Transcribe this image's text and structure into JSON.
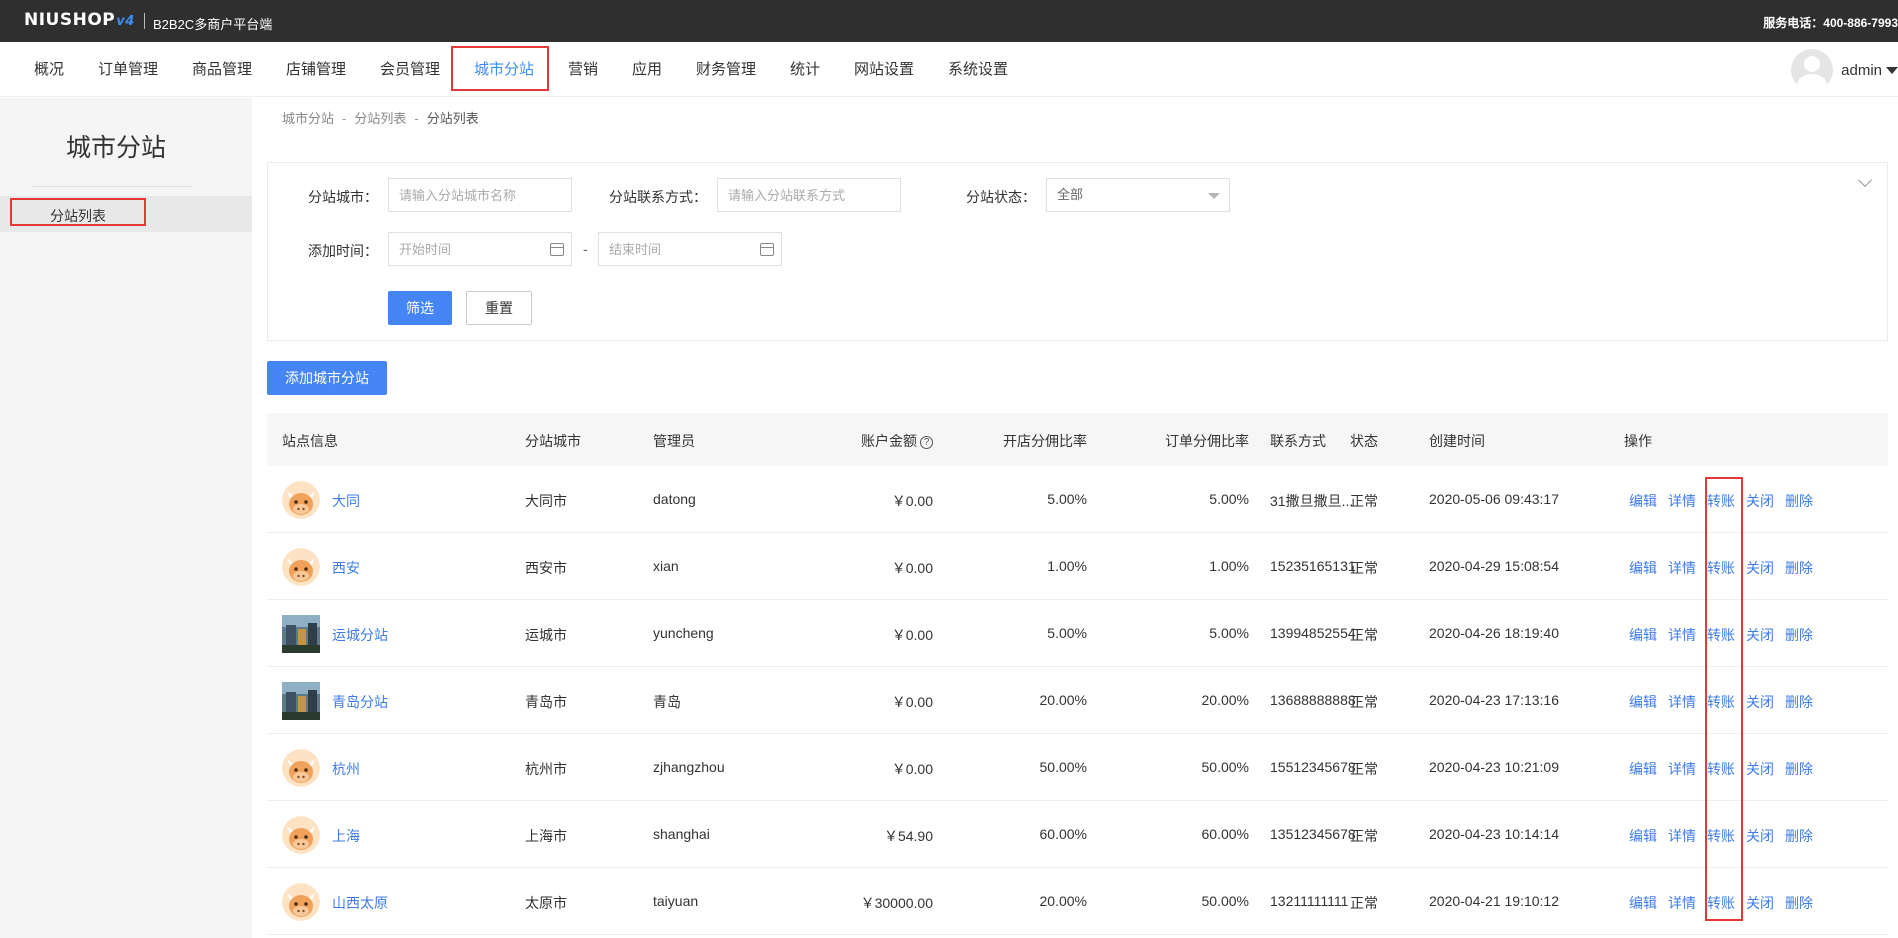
{
  "topbar": {
    "logo_text": "NIUSHOP",
    "logo_version": "v4",
    "platform": "B2B2C多商户平台端",
    "hotline": "服务电话：400-886-7993"
  },
  "nav": {
    "items": [
      "概况",
      "订单管理",
      "商品管理",
      "店铺管理",
      "会员管理",
      "城市分站",
      "营销",
      "应用",
      "财务管理",
      "统计",
      "网站设置",
      "系统设置"
    ],
    "active": "城市分站",
    "user": "admin"
  },
  "sidebar": {
    "title": "城市分站",
    "items": [
      "分站列表"
    ]
  },
  "breadcrumb": [
    "城市分站",
    "分站列表",
    "分站列表"
  ],
  "filter": {
    "city_label": "分站城市：",
    "city_placeholder": "请输入分站城市名称",
    "contact_label": "分站联系方式：",
    "contact_placeholder": "请输入分站联系方式",
    "status_label": "分站状态：",
    "status_value": "全部",
    "time_label": "添加时间：",
    "start_placeholder": "开始时间",
    "end_placeholder": "结束时间",
    "dash": "-",
    "filter_btn": "筛选",
    "reset_btn": "重置"
  },
  "add_btn": "添加城市分站",
  "table": {
    "headers": {
      "site": "站点信息",
      "city": "分站城市",
      "admin": "管理员",
      "balance": "账户金额",
      "shop_rate": "开店分佣比率",
      "order_rate": "订单分佣比率",
      "contact": "联系方式",
      "status": "状态",
      "created": "创建时间",
      "ops": "操作"
    },
    "rows": [
      {
        "name": "大同",
        "city": "大同市",
        "admin": "datong",
        "balance": "￥0.00",
        "shop_rate": "5.00%",
        "order_rate": "5.00%",
        "contact": "31撒旦撒旦...",
        "status": "正常",
        "created": "2020-05-06 09:43:17",
        "avatar": "bull"
      },
      {
        "name": "西安",
        "city": "西安市",
        "admin": "xian",
        "balance": "￥0.00",
        "shop_rate": "1.00%",
        "order_rate": "1.00%",
        "contact": "15235165131",
        "status": "正常",
        "created": "2020-04-29 15:08:54",
        "avatar": "bull"
      },
      {
        "name": "运城分站",
        "city": "运城市",
        "admin": "yuncheng",
        "balance": "￥0.00",
        "shop_rate": "5.00%",
        "order_rate": "5.00%",
        "contact": "13994852554",
        "status": "正常",
        "created": "2020-04-26 18:19:40",
        "avatar": "photo"
      },
      {
        "name": "青岛分站",
        "city": "青岛市",
        "admin": "青岛",
        "balance": "￥0.00",
        "shop_rate": "20.00%",
        "order_rate": "20.00%",
        "contact": "13688888888",
        "status": "正常",
        "created": "2020-04-23 17:13:16",
        "avatar": "photo"
      },
      {
        "name": "杭州",
        "city": "杭州市",
        "admin": "zjhangzhou",
        "balance": "￥0.00",
        "shop_rate": "50.00%",
        "order_rate": "50.00%",
        "contact": "15512345678",
        "status": "正常",
        "created": "2020-04-23 10:21:09",
        "avatar": "bull"
      },
      {
        "name": "上海",
        "city": "上海市",
        "admin": "shanghai",
        "balance": "￥54.90",
        "shop_rate": "60.00%",
        "order_rate": "60.00%",
        "contact": "13512345678",
        "status": "正常",
        "created": "2020-04-23 10:14:14",
        "avatar": "bull"
      },
      {
        "name": "山西太原",
        "city": "太原市",
        "admin": "taiyuan",
        "balance": "￥30000.00",
        "shop_rate": "20.00%",
        "order_rate": "50.00%",
        "contact": "13211111111",
        "status": "正常",
        "created": "2020-04-21 19:10:12",
        "avatar": "bull"
      }
    ],
    "ops": [
      "编辑",
      "详情",
      "转账",
      "关闭",
      "删除"
    ]
  },
  "colors": {
    "primary": "#4685f5",
    "link": "#3d7ce8",
    "highlight": "#e53935",
    "topbar": "#2f2f2f"
  }
}
